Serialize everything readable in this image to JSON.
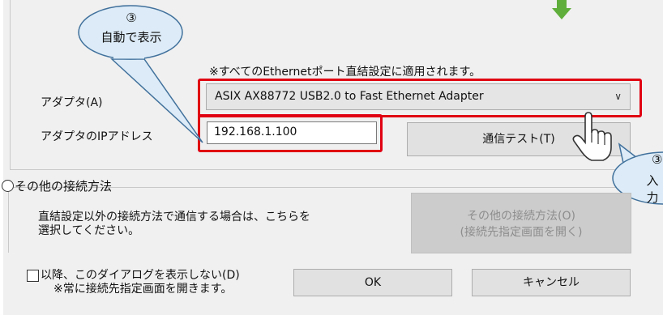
{
  "callout_top": {
    "number": "③",
    "text": "自動で表示"
  },
  "callout_right": {
    "number": "③",
    "text": "入 力"
  },
  "notice": "※すべてのEthernetポート直結設定に適用されます。",
  "adapter": {
    "label": "アダプタ(A)",
    "selected": "ASIX AX88772 USB2.0 to Fast Ethernet Adapter"
  },
  "ip": {
    "label": "アダプタのIPアドレス",
    "value": "192.168.1.100"
  },
  "test_button": "通信テスト(T)",
  "other_method": {
    "radio_label": "その他の接続方法",
    "description_line1": "直結設定以外の接続方法で通信する場合は、こちらを",
    "description_line2": "選択してください。",
    "button_line1": "その他の接続方法(O)",
    "button_line2": "(接続先指定画面を開く)"
  },
  "dont_show": {
    "line1": "以降、このダイアログを表示しない(D)",
    "line2": "※常に接続先指定画面を開きます。"
  },
  "ok_button": "OK",
  "cancel_button": "キャンセル",
  "colors": {
    "highlight": "#e00012",
    "callout_fill": "#dcebf7",
    "callout_border": "#41719c",
    "arrow": "#5fae3b"
  },
  "icons": [
    "chevron-down-icon",
    "hand-pointer-icon",
    "down-arrow-icon"
  ]
}
